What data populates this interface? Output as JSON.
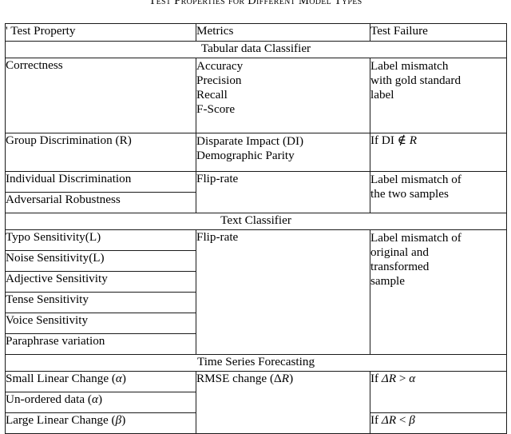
{
  "caption": "Test Properties for Different Model Types",
  "table": {
    "headers": {
      "property": "' Test Property",
      "metrics": "Metrics",
      "failure": "Test Failure"
    },
    "sections": [
      {
        "title": "Tabular data Classifier",
        "groups": [
          {
            "properties": [
              "Correctness"
            ],
            "metrics": [
              "Accuracy",
              "Precision",
              "Recall",
              "F-Score"
            ],
            "failure": [
              "Label mismatch",
              "with gold standard",
              "label"
            ]
          },
          {
            "properties": [
              "Group Discrimination (R)"
            ],
            "metrics": [
              "Disparate Impact (DI)",
              "Demographic Parity"
            ],
            "failure_prefix": "If DI ",
            "failure_symbol": "∉",
            "failure_var": "R"
          },
          {
            "properties": [
              "Individual Discrimination",
              "Adversarial Robustness"
            ],
            "metrics": [
              "Flip-rate"
            ],
            "failure": [
              "Label mismatch of",
              "the two samples"
            ]
          }
        ]
      },
      {
        "title": "Text Classifier",
        "groups": [
          {
            "properties": [
              "Typo Sensitivity(L)",
              "Noise Sensitivity(L)",
              "Adjective Sensitivity",
              "Tense Sensitivity",
              "Voice Sensitivity",
              "Paraphrase variation"
            ],
            "metrics": [
              "Flip-rate"
            ],
            "failure": [
              "Label mismatch of",
              "original and",
              "transformed",
              "sample"
            ]
          }
        ]
      },
      {
        "title": "Time Series Forecasting",
        "groups": [
          {
            "properties": [
              "Small Linear Change (α)",
              "Un-ordered data (α)"
            ],
            "metrics": [
              "RMSE change (ΔR)"
            ],
            "failure": [
              "If ΔR > α"
            ]
          },
          {
            "properties": [
              "Large Linear Change (β)"
            ],
            "metrics": [],
            "failure": [
              "If ΔR < β"
            ]
          }
        ]
      }
    ]
  },
  "rows": {
    "prop_correctness": "Correctness",
    "prop_group_disc": "Group Discrimination (R)",
    "prop_indiv_disc": "Individual Discrimination",
    "prop_adv_robust": "Adversarial Robustness",
    "prop_typo": "Typo Sensitivity(L)",
    "prop_noise": "Noise Sensitivity(L)",
    "prop_adjective": "Adjective Sensitivity",
    "prop_tense": "Tense Sensitivity",
    "prop_voice": "Voice Sensitivity",
    "prop_paraphrase": "Paraphrase variation",
    "prop_small_linear": "Small Linear Change (",
    "prop_small_linear_sym": "α",
    "prop_small_linear_end": ")",
    "prop_unordered": "Un-ordered data (",
    "prop_unordered_sym": "α",
    "prop_unordered_end": ")",
    "prop_large_linear": "Large Linear Change (",
    "prop_large_linear_sym": "β",
    "prop_large_linear_end": ")",
    "met_accuracy": "Accuracy",
    "met_precision": "Precision",
    "met_recall": "Recall",
    "met_fscore": "F-Score",
    "met_disparate": "Disparate Impact (DI)",
    "met_demographic": "Demographic Parity",
    "met_fliprate_1": "Flip-rate",
    "met_fliprate_2": "Flip-rate",
    "met_rmse_pre": "RMSE change (",
    "met_rmse_delta": "Δ",
    "met_rmse_var": "R",
    "met_rmse_end": ")",
    "fail_label_mismatch_1": "Label mismatch",
    "fail_label_mismatch_2": "with gold standard",
    "fail_label_mismatch_3": "label",
    "fail_if_di": "If DI ",
    "fail_notin": "∉",
    "fail_r": "R",
    "fail_two_samples_1": "Label mismatch of",
    "fail_two_samples_2": "the two samples",
    "fail_transformed_1": "Label mismatch of",
    "fail_transformed_2": "original and",
    "fail_transformed_3": "transformed",
    "fail_transformed_4": "sample",
    "fail_gt_pre": "If ",
    "fail_gt_delta": "ΔR",
    "fail_gt_op": " > ",
    "fail_gt_sym": "α",
    "fail_lt_pre": "If ",
    "fail_lt_delta": "ΔR",
    "fail_lt_op": " < ",
    "fail_lt_sym": "β"
  },
  "sections": {
    "tabular": "Tabular data Classifier",
    "text": "Text Classifier",
    "timeseries": "Time Series Forecasting"
  }
}
